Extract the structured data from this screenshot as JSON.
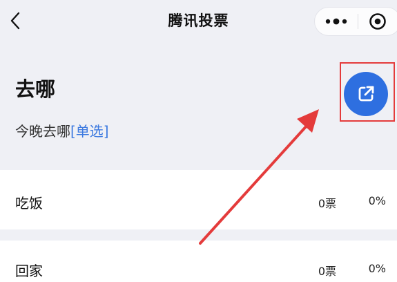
{
  "nav": {
    "title": "腾讯投票",
    "back_icon": "chevron-left-icon",
    "more_icon": "more-dots-icon",
    "close_icon": "target-circle-icon"
  },
  "vote": {
    "title": "去哪",
    "description": "今晚去哪",
    "type_tag": "[单选]"
  },
  "share": {
    "icon": "external-link-icon",
    "color": "#2e6fe0",
    "highlight_color": "#e43b3b"
  },
  "options": [
    {
      "label": "吃饭",
      "votes": "0票",
      "percent": "0%"
    },
    {
      "label": "回家",
      "votes": "0票",
      "percent": "0%"
    }
  ],
  "colors": {
    "page_bg": "#eff0f5",
    "accent_blue": "#3d7ae0",
    "annotation_red": "#e43b3b"
  }
}
